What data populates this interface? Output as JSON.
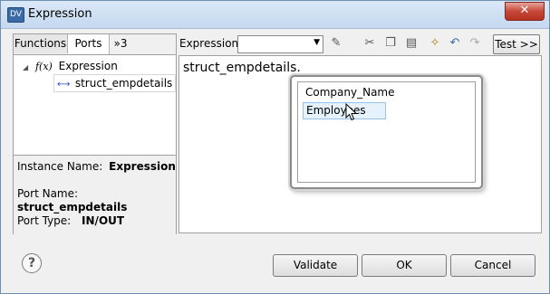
{
  "window": {
    "title": "Expression",
    "app_icon_text": "DV",
    "close_symbol": "✕"
  },
  "left_panel": {
    "tabs": [
      {
        "label": "Functions"
      },
      {
        "label": "Ports"
      },
      {
        "label": "»3"
      }
    ],
    "tree": {
      "root": {
        "prefix": "f(x)",
        "label": "Expression",
        "toggle": "◢"
      },
      "child": {
        "label": "struct_empdetails"
      }
    },
    "properties": {
      "instance_name_label": "Instance Name:",
      "instance_name_value": "Expression",
      "port_name_label": "Port Name:",
      "port_name_value": "struct_empdetails",
      "port_type_label": "Port Type:",
      "port_type_value": "IN/OUT"
    }
  },
  "toolbar": {
    "expression_label": "Expression:",
    "expression_select_value": "",
    "test_label": "Test >>"
  },
  "editor": {
    "text": "struct_empdetails."
  },
  "autocomplete": {
    "items": [
      {
        "label": "Company_Name"
      },
      {
        "label": "Employees"
      }
    ]
  },
  "footer": {
    "help_symbol": "?",
    "validate_label": "Validate",
    "ok_label": "OK",
    "cancel_label": "Cancel"
  }
}
